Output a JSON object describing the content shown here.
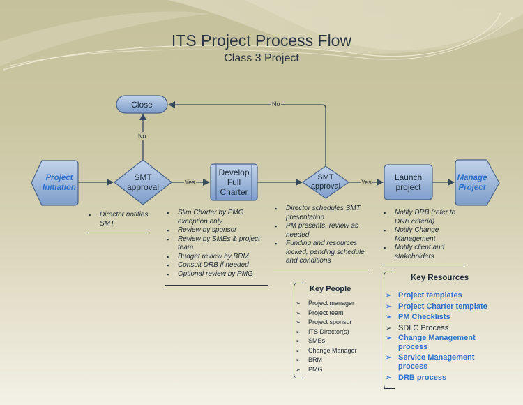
{
  "title": "ITS Project Process Flow",
  "subtitle": "Class 3 Project",
  "nodes": {
    "initiation": "Project Initiation",
    "smt1": "SMT approval",
    "develop": "Develop Full Charter",
    "smt2": "SMT approval",
    "launch": "Launch project",
    "manage": "Manage Project",
    "close": "Close"
  },
  "edges": {
    "yes1": "Yes",
    "yes2": "Yes",
    "no1": "No",
    "no2": "No"
  },
  "notes": {
    "initiation": [
      "Director notifies SMT"
    ],
    "develop": [
      "Slim Charter by PMG exception only",
      "Review by sponsor",
      "Review by SMEs & project team",
      "Budget review by BRM",
      "Consult DRB if needed",
      "Optional review by PMG"
    ],
    "smt2": [
      "Director schedules SMT presentation",
      "PM presents, review as needed",
      "Funding and resources locked, pending schedule and conditions"
    ],
    "launch": [
      "Notify DRB (refer to DRB criteria)",
      "Notify Change Management",
      "Notify client and stakeholders"
    ]
  },
  "key_people": {
    "title": "Key People",
    "items": [
      "Project manager",
      "Project team",
      "Project sponsor",
      "ITS Director(s)",
      "SMEs",
      "Change Manager",
      "BRM",
      "PMG"
    ]
  },
  "key_resources": {
    "title": "Key Resources",
    "items": [
      {
        "label": "Project templates",
        "link": true
      },
      {
        "label": "Project Charter template",
        "link": true
      },
      {
        "label": "PM Checklists",
        "link": true
      },
      {
        "label": "SDLC Process",
        "link": false
      },
      {
        "label": "Change Management process",
        "link": true
      },
      {
        "label": "Service Management process",
        "link": true
      },
      {
        "label": "DRB process",
        "link": true
      }
    ]
  },
  "colors": {
    "shape_fill_top": "#b9cde8",
    "shape_fill_bottom": "#7f9fcc",
    "shape_stroke": "#4a6489",
    "connector": "#34495e",
    "link": "#2e6fc7"
  }
}
